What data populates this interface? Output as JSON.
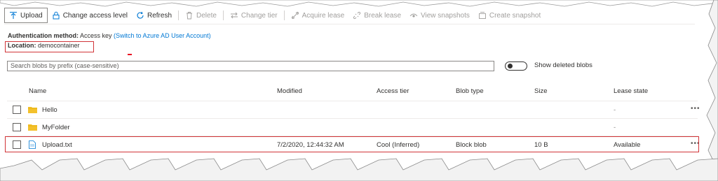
{
  "toolbar": {
    "upload": "Upload",
    "change_access_level": "Change access level",
    "refresh": "Refresh",
    "delete": "Delete",
    "change_tier": "Change tier",
    "acquire_lease": "Acquire lease",
    "break_lease": "Break lease",
    "view_snapshots": "View snapshots",
    "create_snapshot": "Create snapshot"
  },
  "auth": {
    "label": "Authentication method:",
    "value": "Access key",
    "link": "(Switch to Azure AD User Account)"
  },
  "location": {
    "label": "Location:",
    "value": "democontainer"
  },
  "search": {
    "placeholder": "Search blobs by prefix (case-sensitive)"
  },
  "show_deleted": {
    "label": "Show deleted blobs",
    "on": false
  },
  "columns": [
    "Name",
    "Modified",
    "Access tier",
    "Blob type",
    "Size",
    "Lease state"
  ],
  "rows": [
    {
      "name": "Hello",
      "kind": "folder",
      "modified": "",
      "access_tier": "",
      "blob_type": "",
      "size": "",
      "lease_state": "-"
    },
    {
      "name": "MyFolder",
      "kind": "folder",
      "modified": "",
      "access_tier": "",
      "blob_type": "",
      "size": "",
      "lease_state": "-"
    },
    {
      "name": "Upload.txt",
      "kind": "file",
      "modified": "7/2/2020, 12:44:32 AM",
      "access_tier": "Cool (Inferred)",
      "blob_type": "Block blob",
      "size": "10 B",
      "lease_state": "Available"
    }
  ],
  "more_glyph": "•••",
  "colors": {
    "accent": "#0078d4",
    "highlight": "#d13438",
    "folder": "#f3c12c"
  }
}
